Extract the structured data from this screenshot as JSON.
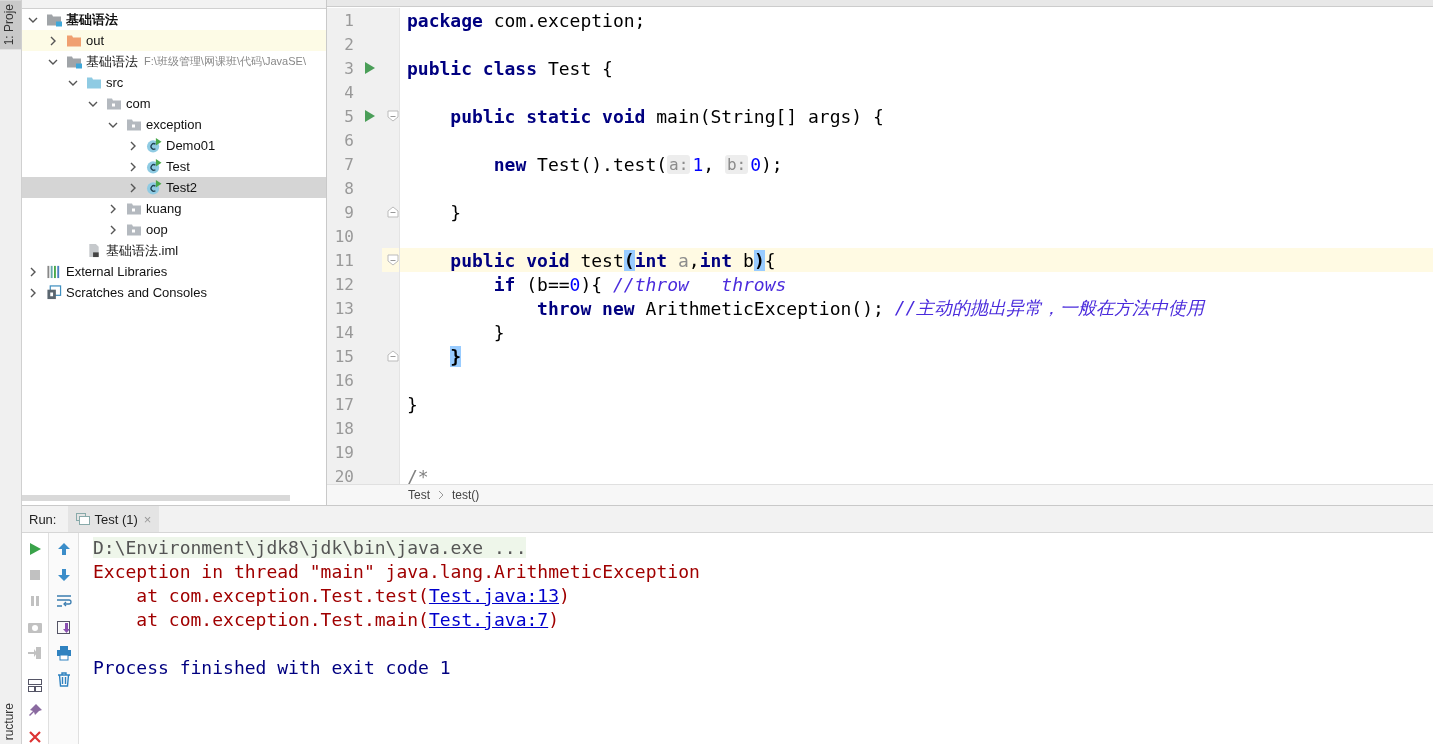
{
  "side_tools": [
    {
      "label": "1: Proje",
      "selected": true
    },
    {
      "label": "ructure",
      "selected": false
    }
  ],
  "project_tree": [
    {
      "label": "基础语法",
      "kind": "project",
      "expanded": true,
      "selected": false,
      "children": [
        {
          "label": "out",
          "kind": "excluded-folder",
          "expanded": false,
          "selected": false
        },
        {
          "label": "基础语法",
          "path": "F:\\班级管理\\网课班\\代码\\JavaSE\\",
          "kind": "module",
          "expanded": true,
          "selected": false,
          "children": [
            {
              "label": "src",
              "kind": "source-folder",
              "expanded": true,
              "selected": false,
              "children": [
                {
                  "label": "com",
                  "kind": "package",
                  "expanded": true,
                  "selected": false,
                  "children": [
                    {
                      "label": "exception",
                      "kind": "package",
                      "expanded": true,
                      "selected": false,
                      "children": [
                        {
                          "label": "Demo01",
                          "kind": "class",
                          "expanded": false,
                          "selected": false
                        },
                        {
                          "label": "Test",
                          "kind": "class",
                          "expanded": false,
                          "selected": false
                        },
                        {
                          "label": "Test2",
                          "kind": "class",
                          "expanded": false,
                          "selected": true
                        }
                      ]
                    },
                    {
                      "label": "kuang",
                      "kind": "package",
                      "expanded": false,
                      "selected": false
                    },
                    {
                      "label": "oop",
                      "kind": "package",
                      "expanded": false,
                      "selected": false
                    }
                  ]
                }
              ]
            },
            {
              "label": "基础语法.iml",
              "kind": "iml",
              "selected": false
            }
          ]
        }
      ]
    },
    {
      "label": "External Libraries",
      "kind": "libraries",
      "expanded": false,
      "selected": false
    },
    {
      "label": "Scratches and Consoles",
      "kind": "scratches",
      "expanded": false,
      "selected": false
    }
  ],
  "editor": {
    "lines": [
      {
        "number": "1",
        "kind": "plain",
        "tokens": [
          {
            "kind": "kw",
            "text": "package"
          },
          {
            "kind": "plain",
            "text": " com.exception;"
          }
        ]
      },
      {
        "number": "2",
        "kind": "plain"
      },
      {
        "number": "3",
        "kind": "plain",
        "run": true,
        "tokens": [
          {
            "kind": "kw",
            "text": "public class"
          },
          {
            "kind": "plain",
            "text": " Test {"
          }
        ]
      },
      {
        "number": "4",
        "kind": "plain"
      },
      {
        "number": "5",
        "kind": "fold-start",
        "run": true,
        "tokens": [
          {
            "kind": "kw",
            "text": "    public static void"
          },
          {
            "kind": "plain",
            "text": " main(String[] args) {"
          }
        ]
      },
      {
        "number": "6",
        "kind": "plain"
      },
      {
        "number": "7",
        "kind": "plain",
        "tokens": [
          {
            "kind": "kw",
            "text": "        new"
          },
          {
            "kind": "plain",
            "text": " Test().test("
          },
          {
            "kind": "hint",
            "text": "a:"
          },
          {
            "kind": "num",
            "text": "1"
          },
          {
            "kind": "plain",
            "text": ", "
          },
          {
            "kind": "hint",
            "text": "b:"
          },
          {
            "kind": "num",
            "text": "0"
          },
          {
            "kind": "plain",
            "text": ");"
          }
        ]
      },
      {
        "number": "8",
        "kind": "plain"
      },
      {
        "number": "9",
        "kind": "fold-end",
        "tokens": [
          {
            "kind": "plain",
            "text": "    }"
          }
        ]
      },
      {
        "number": "10",
        "kind": "plain"
      },
      {
        "number": "11",
        "kind": "fold-start",
        "current": true,
        "tokens": [
          {
            "kind": "kw",
            "text": "    public void"
          },
          {
            "kind": "plain",
            "text": " test"
          },
          {
            "kind": "match",
            "text": "("
          },
          {
            "kind": "kw",
            "text": "int"
          },
          {
            "kind": "unused",
            "text": " a"
          },
          {
            "kind": "plain",
            "text": ","
          },
          {
            "kind": "kw",
            "text": "int"
          },
          {
            "kind": "plain",
            "text": " b"
          },
          {
            "kind": "match",
            "text": ")"
          },
          {
            "kind": "plain",
            "text": "{"
          }
        ]
      },
      {
        "number": "12",
        "kind": "plain",
        "tokens": [
          {
            "kind": "kw",
            "text": "        if"
          },
          {
            "kind": "plain",
            "text": " (b=="
          },
          {
            "kind": "num",
            "text": "0"
          },
          {
            "kind": "plain",
            "text": "){ "
          },
          {
            "kind": "comment",
            "text": "//throw   throws"
          }
        ]
      },
      {
        "number": "13",
        "kind": "plain",
        "tokens": [
          {
            "kind": "kw",
            "text": "            throw new"
          },
          {
            "kind": "plain",
            "text": " ArithmeticException(); "
          },
          {
            "kind": "comment",
            "text": "//主动的抛出异常，一般在方法中使用"
          }
        ]
      },
      {
        "number": "14",
        "kind": "plain",
        "tokens": [
          {
            "kind": "plain",
            "text": "        }"
          }
        ]
      },
      {
        "number": "15",
        "kind": "fold-end",
        "tokens": [
          {
            "kind": "match",
            "text": "    }"
          }
        ]
      },
      {
        "number": "16",
        "kind": "plain"
      },
      {
        "number": "17",
        "kind": "plain",
        "tokens": [
          {
            "kind": "plain",
            "text": "}"
          }
        ]
      },
      {
        "number": "18",
        "kind": "plain"
      },
      {
        "number": "19",
        "kind": "plain"
      },
      {
        "number": "20",
        "kind": "plain",
        "tokens": [
          {
            "kind": "doc",
            "text": "/*"
          }
        ]
      }
    ],
    "breadcrumbs": [
      "Test",
      "test()"
    ]
  },
  "run_panel": {
    "label": "Run:",
    "tab": {
      "label": "Test (1)",
      "close": "×",
      "selected": true
    },
    "left_tools": [
      {
        "kind": "rerun",
        "disabled": false
      },
      {
        "kind": "stop",
        "disabled": true
      },
      {
        "kind": "pause",
        "disabled": true
      },
      {
        "kind": "camera",
        "disabled": true
      },
      {
        "kind": "exit",
        "disabled": true
      },
      {
        "kind": "layout",
        "disabled": false
      },
      {
        "kind": "pin",
        "disabled": false
      },
      {
        "kind": "close",
        "disabled": false
      }
    ],
    "right_tools": [
      {
        "kind": "up"
      },
      {
        "kind": "down"
      },
      {
        "kind": "wrap"
      },
      {
        "kind": "scroll-end"
      },
      {
        "kind": "print"
      },
      {
        "kind": "trash"
      }
    ],
    "console": [
      {
        "kind": "command",
        "text": "D:\\Environment\\jdk8\\jdk\\bin\\java.exe ..."
      },
      {
        "kind": "error",
        "text": "Exception in thread \"main\" java.lang.ArithmeticException"
      },
      {
        "kind": "error",
        "text": "    at com.exception.Test.test(",
        "link": "Test.java:13",
        "after": ")"
      },
      {
        "kind": "error",
        "text": "    at com.exception.Test.main(",
        "link": "Test.java:7",
        "after": ")"
      },
      {
        "kind": "exit",
        "text": "Process finished with exit code 1"
      }
    ]
  }
}
